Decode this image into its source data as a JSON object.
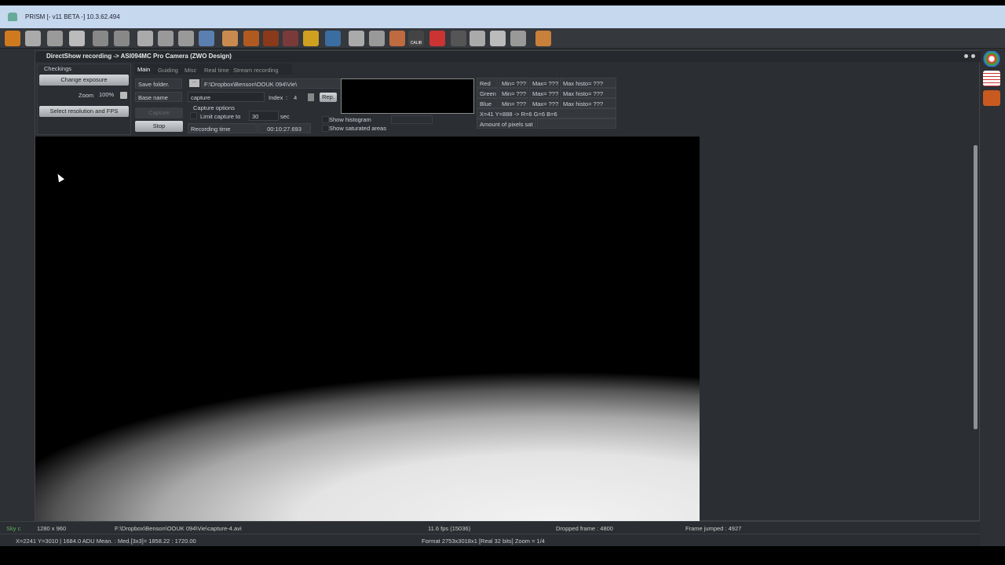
{
  "window": {
    "title": "PRISM [- v11 BETA -] 10.3.62.494"
  },
  "toolbar": {
    "icons": [
      "camera-icon",
      "save-icon",
      "tools-icon",
      "info-icon",
      "rotate-left-icon",
      "rotate-right-icon",
      "contrast-icon",
      "zoom-out-icon",
      "magic-wand-icon",
      "image-view-icon",
      "settings-gear-icon",
      "camera-1-icon",
      "camera-2-icon",
      "camera-3-icon",
      "filter-wheel-icon",
      "telescope-icon",
      "drop-icon",
      "globe-icon",
      "tool-icon",
      "calib-icon",
      "stop-icon",
      "line-icon",
      "hand-icon",
      "blank-icon",
      "histogram-icon",
      "user-icon"
    ],
    "calib_label": "CALIB"
  },
  "dialog": {
    "title": "DirectShow recording -> ASI094MC Pro Camera (ZWO Design)",
    "checkings": {
      "label": "Checkings",
      "change_exposure": "Change exposure",
      "zoom_label": "Zoom",
      "zoom_value": "100%",
      "select_resolution": "Select resolution and FPS"
    },
    "tabs": [
      "Main",
      "Guiding",
      "Misc",
      "Real time",
      "Stream recording"
    ],
    "save_folder_label": "Save folder.",
    "browse": "...",
    "save_folder": "F:\\Dropbox\\Benson\\OOUK 094\\Vie\\",
    "base_name_label": "Base name",
    "base_name": "capture",
    "index_label": "Index",
    "index_sep": ":",
    "index_value": "4",
    "rep": "Rep.",
    "capture": "Capture",
    "stop": "Stop",
    "capture_options": "Capture options",
    "limit_capture": "Limit capture to",
    "limit_value": "30",
    "limit_unit": "sec",
    "recording_time_label": "Recording time",
    "recording_time": "00:10:27.693",
    "show_histogram": "Show histogram",
    "show_saturated": "Show saturated areas",
    "channels": [
      {
        "name": "Red",
        "min": "Min= ???",
        "max": "Max= ???",
        "histo": "Max histo= ???"
      },
      {
        "name": "Green",
        "min": "Min= ???",
        "max": "Max= ???",
        "histo": "Max histo= ???"
      },
      {
        "name": "Blue",
        "min": "Min= ???",
        "max": "Max= ???",
        "histo": "Max histo= ???"
      }
    ],
    "pixel_readout": "X=41 Y=888 -> R=6 G=6 B=6",
    "pixels_sat_label": "Amount of pixels sat"
  },
  "status1": {
    "sky": "Sky c",
    "resolution": "1280 x 960",
    "file": "F:\\Dropbox\\Benson\\OOUK 094\\Vie\\capture-4.avi",
    "fps": "11.6 fps (15036)",
    "dropped": "Dropped frame : 4800",
    "jumped": "Frame jumped : 4927"
  },
  "status2": {
    "coords": "X=2241 Y=3010 | 1684.0 ADU   Mean. : Med.[3x3]= 1858.22 : 1720.00",
    "format": "Format 2753x3018x1 [Real 32 bits]  Zoom = 1/4"
  }
}
